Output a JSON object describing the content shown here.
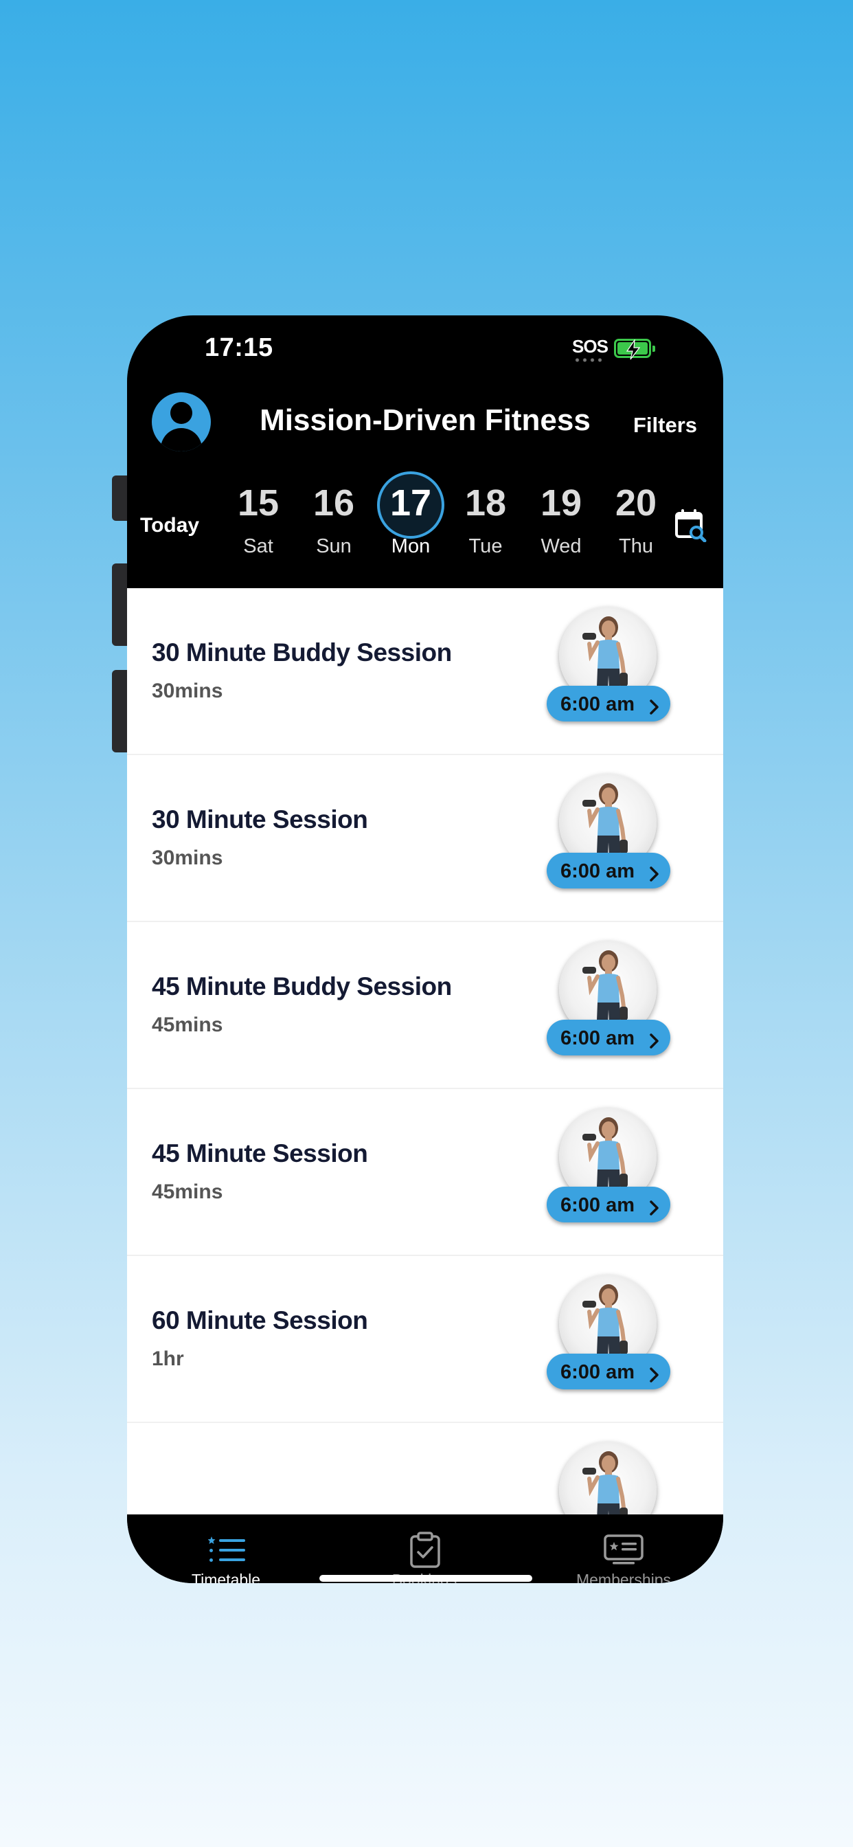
{
  "status_bar": {
    "time": "17:15",
    "sos": "SOS"
  },
  "header": {
    "title": "Mission-Driven Fitness",
    "filters_label": "Filters"
  },
  "date_strip": {
    "today_label": "Today",
    "days": [
      {
        "num": "15",
        "name": "Sat"
      },
      {
        "num": "16",
        "name": "Sun"
      },
      {
        "num": "17",
        "name": "Mon"
      },
      {
        "num": "18",
        "name": "Tue"
      },
      {
        "num": "19",
        "name": "Wed"
      },
      {
        "num": "20",
        "name": "Thu"
      }
    ],
    "selected_index": 2
  },
  "sessions": [
    {
      "name": "30 Minute Buddy Session",
      "duration": "30mins",
      "time": "6:00 am"
    },
    {
      "name": "30 Minute Session",
      "duration": "30mins",
      "time": "6:00 am"
    },
    {
      "name": "45 Minute Buddy Session",
      "duration": "45mins",
      "time": "6:00 am"
    },
    {
      "name": "45 Minute Session",
      "duration": "45mins",
      "time": "6:00 am"
    },
    {
      "name": "60 Minute Session",
      "duration": "1hr",
      "time": "6:00 am"
    }
  ],
  "tabs": [
    {
      "label": "Timetable",
      "icon": "list-icon"
    },
    {
      "label": "Bookings",
      "icon": "clipboard-check-icon"
    },
    {
      "label": "Memberships",
      "icon": "membership-card-icon"
    }
  ],
  "colors": {
    "accent": "#3aa2e0",
    "background_top": "#3aaee7",
    "dark": "#000000"
  }
}
